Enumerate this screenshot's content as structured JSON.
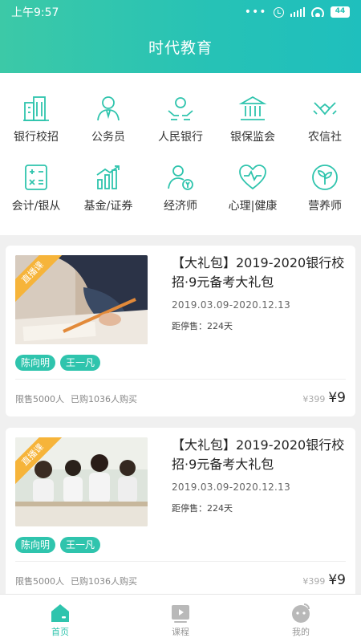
{
  "status_bar": {
    "time": "上午9:57",
    "battery": "44"
  },
  "app_title": "时代教育",
  "colors": {
    "brand": "#26c2b6",
    "tag": "#2fc4ad",
    "ribbon": "#f6b43a"
  },
  "categories": [
    {
      "label": "银行校招",
      "icon": "bank-building-icon"
    },
    {
      "label": "公务员",
      "icon": "civil-servant-icon"
    },
    {
      "label": "人民银行",
      "icon": "hands-coin-icon"
    },
    {
      "label": "银保监会",
      "icon": "government-building-icon"
    },
    {
      "label": "农信社",
      "icon": "handshake-icon"
    },
    {
      "label": "会计/银从",
      "icon": "calculator-icon"
    },
    {
      "label": "基金/证券",
      "icon": "bar-chart-icon"
    },
    {
      "label": "经济师",
      "icon": "economist-icon"
    },
    {
      "label": "心理|健康",
      "icon": "heart-pulse-icon"
    },
    {
      "label": "营养师",
      "icon": "leaf-icon"
    }
  ],
  "courses": [
    {
      "badge": "直播课",
      "title": "【大礼包】2019-2020银行校招·9元备考大礼包",
      "date_range": "2019.03.09-2020.12.13",
      "stop_sale": "距停售：224天",
      "teachers": [
        "陈向明",
        "王一凡"
      ],
      "limit": "限售5000人",
      "bought": "已购1036人购买",
      "old_price": "¥399",
      "price": "¥9"
    },
    {
      "badge": "直播课",
      "title": "【大礼包】2019-2020银行校招·9元备考大礼包",
      "date_range": "2019.03.09-2020.12.13",
      "stop_sale": "距停售：224天",
      "teachers": [
        "陈向明",
        "王一凡"
      ],
      "limit": "限售5000人",
      "bought": "已购1036人购买",
      "old_price": "¥399",
      "price": "¥9"
    }
  ],
  "tabs": [
    {
      "label": "首页",
      "icon": "home-icon",
      "active": true
    },
    {
      "label": "课程",
      "icon": "course-play-icon",
      "active": false
    },
    {
      "label": "我的",
      "icon": "profile-icon",
      "active": false
    }
  ]
}
